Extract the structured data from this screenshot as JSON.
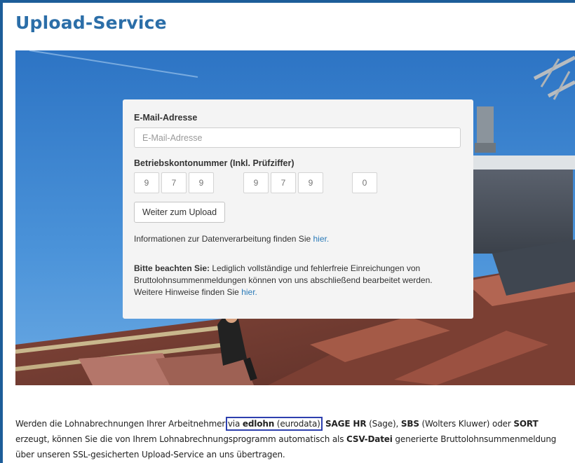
{
  "page": {
    "title": "Upload-Service"
  },
  "form": {
    "email_label": "E-Mail-Adresse",
    "email_placeholder": "E-Mail-Adresse",
    "account_label": "Betriebskontonummer (Inkl. Prüfziffer)",
    "account_digits": [
      "9",
      "7",
      "9",
      "9",
      "7",
      "9",
      "0"
    ],
    "upload_button": "Weiter zum Upload",
    "privacy_text": "Informationen zur Datenverarbeitung finden Sie ",
    "privacy_link": "hier.",
    "notice_bold": "Bitte beachten Sie:",
    "notice_text": " Lediglich vollständige und fehlerfreie Einreichungen von Bruttolohnsummenmeldungen können von uns abschließend bearbeitet werden. Weitere Hinweise finden Sie ",
    "notice_link": "hier."
  },
  "paragraph": {
    "t1": "Werden die Lohnabrechnungen Ihrer Arbeitnehmer ",
    "t2": "via ",
    "b1": "edlohn",
    "t3": " (eurodata)",
    "t4": ", ",
    "b2": "SAGE HR",
    "t5": " (Sage), ",
    "b3": "SBS",
    "t6": " (Wolters Kluwer) oder ",
    "b4": "SORT",
    "t7": " erzeugt, können Sie die von Ihrem Lohnabrechnungsprogramm automatisch als ",
    "b5": "CSV-Datei",
    "t8": " generierte Bruttolohnsummenmeldung über unseren SSL-gesicherten Upload-Service an uns übertragen."
  },
  "colors": {
    "frame": "#1d5d99",
    "title": "#2b6ea8",
    "link": "#2a7ab8",
    "highlight": "#2d3fae"
  },
  "icons": [
    "hero-photo-roofer"
  ]
}
